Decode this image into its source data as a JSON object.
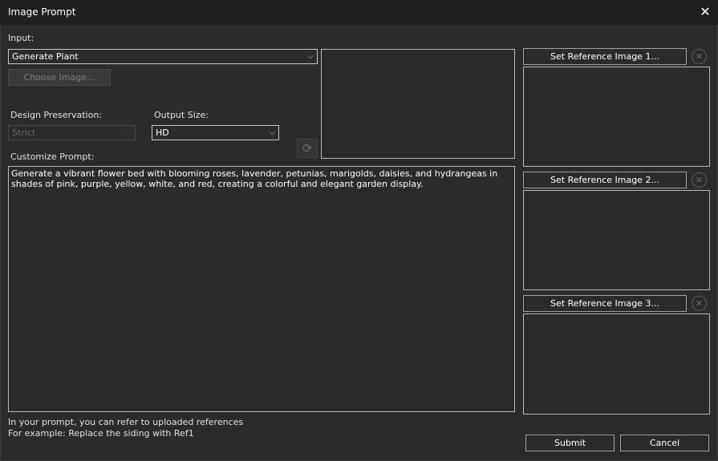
{
  "window": {
    "title": "Image Prompt",
    "close_glyph": "✕"
  },
  "input": {
    "label": "Input:",
    "selected": "Generate Plant",
    "choose_button": "Choose Image..."
  },
  "design_preservation": {
    "label": "Design Preservation:",
    "selected": "Strict"
  },
  "output_size": {
    "label": "Output Size:",
    "selected": "HD"
  },
  "prompt": {
    "label": "Customize Prompt:",
    "value": "Generate a vibrant flower bed with blooming roses, lavender, petunias, marigolds, daisies, and hydrangeas in shades of pink, purple, yellow, white, and red, creating a colorful and elegant garden display."
  },
  "references": [
    {
      "button": "Set Reference Image 1..."
    },
    {
      "button": "Set Reference Image 2..."
    },
    {
      "button": "Set Reference Image 3..."
    }
  ],
  "hint": {
    "line1": "In your prompt, you can refer to uploaded references",
    "line2": "For example: Replace the siding with Ref1"
  },
  "actions": {
    "submit": "Submit",
    "cancel": "Cancel"
  },
  "icons": {
    "chevron": "⌵",
    "remove": "✕",
    "refresh": "⟳"
  }
}
